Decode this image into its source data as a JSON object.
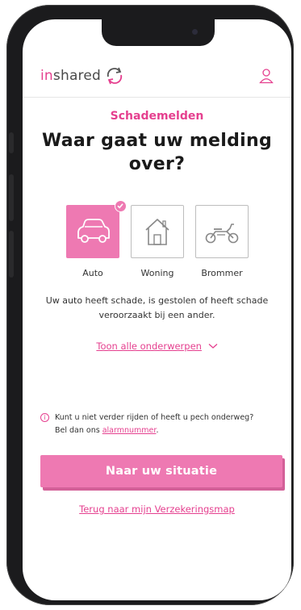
{
  "header": {
    "logo_prefix": "in",
    "logo_suffix": "shared"
  },
  "page": {
    "eyebrow": "Schademelden",
    "title": "Waar gaat uw melding over?"
  },
  "options": [
    {
      "label": "Auto",
      "selected": true
    },
    {
      "label": "Woning",
      "selected": false
    },
    {
      "label": "Brommer",
      "selected": false
    }
  ],
  "description": "Uw auto heeft schade, is gestolen of heeft schade veroorzaakt bij een ander.",
  "toon_link": "Toon alle onderwerpen",
  "info": {
    "line1": "Kunt u niet verder rijden of heeft u pech onderweg?",
    "line2_prefix": "Bel dan ons ",
    "alarm_link": "alarmnummer",
    "line2_suffix": "."
  },
  "cta_label": "Naar uw situatie",
  "back_link": "Terug naar mijn Verzekeringsmap",
  "colors": {
    "brand": "#e5408f",
    "tile_selected": "#ee79b2",
    "frame": "#1b1b1d"
  },
  "icons": [
    "logo-swirl-icon",
    "user-icon",
    "car-icon",
    "house-icon",
    "scooter-icon",
    "checkmark-icon",
    "chevron-down-icon",
    "info-icon"
  ]
}
